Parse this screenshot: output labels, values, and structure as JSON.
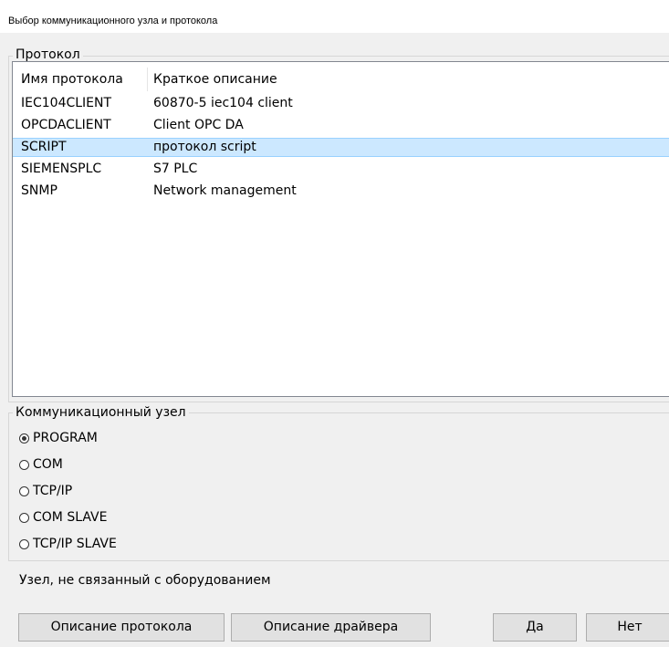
{
  "window": {
    "title": "Выбор коммуникационного узла и протокола"
  },
  "protocol_group": {
    "legend": "Протокол",
    "columns": [
      "Имя протокола",
      "Краткое описание"
    ],
    "rows": [
      {
        "name": "IEC104CLIENT",
        "description": "60870-5 iec104 client"
      },
      {
        "name": "OPCDACLIENT",
        "description": "Client OPC DA"
      },
      {
        "name": "SCRIPT",
        "description": "протокол script",
        "selected": true
      },
      {
        "name": "SIEMENSPLC",
        "description": "S7 PLC"
      },
      {
        "name": "SNMP",
        "description": "Network management"
      }
    ]
  },
  "node_group": {
    "legend": "Коммуникационный узел",
    "options": [
      {
        "label": "PROGRAM",
        "checked": true
      },
      {
        "label": "COM",
        "checked": false
      },
      {
        "label": "TCP/IP",
        "checked": false
      },
      {
        "label": "COM SLAVE",
        "checked": false
      },
      {
        "label": "TCP/IP SLAVE",
        "checked": false
      }
    ],
    "description": "Узел, не связанный с оборудованием"
  },
  "buttons": {
    "protocol_desc": "Описание протокола",
    "driver_desc": "Описание драйвера",
    "yes": "Да",
    "no": "Нет"
  },
  "colors": {
    "selection": "#cce8ff",
    "background": "#f0f0f0"
  }
}
